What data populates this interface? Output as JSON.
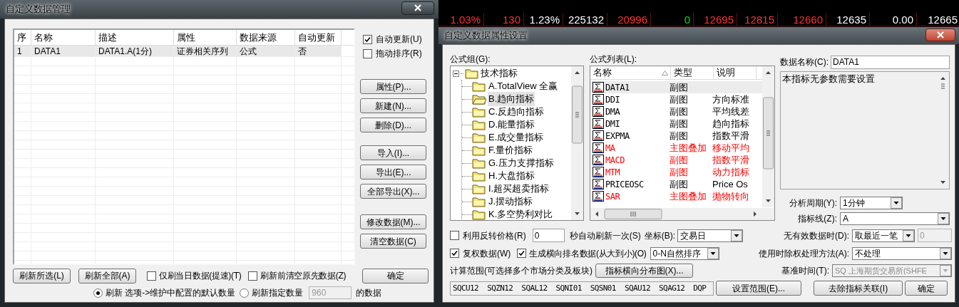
{
  "ticker": {
    "rows": [
      {
        "cells": [
          {
            "text": "1.03%",
            "color": "#ff3232"
          },
          {
            "text": "130",
            "color": "#ff3232"
          },
          {
            "text": "1.23%",
            "color": "#ffffff"
          },
          {
            "text": "225132",
            "color": "#ffffff"
          },
          {
            "text": "20996",
            "color": "#ff3232"
          },
          {
            "text": "0",
            "color": "#00e600"
          },
          {
            "text": "12695",
            "color": "#ff3232"
          },
          {
            "text": "12815",
            "color": "#ff3232"
          },
          {
            "text": "12660",
            "color": "#ff3232"
          },
          {
            "text": "12635",
            "color": "#ffffff"
          },
          {
            "text": "0.00",
            "color": "#ffffff"
          },
          {
            "text": "12665",
            "color": "#ffffff"
          }
        ]
      }
    ]
  },
  "manager": {
    "title": "自定义数据管理",
    "columns": [
      "序",
      "名称",
      "描述",
      "属性",
      "数据来源",
      "自动更新"
    ],
    "rows": [
      {
        "cells": [
          "1",
          "DATA1",
          "DATA1.A(1分)",
          "证券相关序列",
          "公式",
          "否"
        ],
        "selected": true
      }
    ],
    "options": [
      {
        "label": "自动更新(U)",
        "checked": true
      },
      {
        "label": "拖动排序(R)",
        "checked": false
      }
    ],
    "button_groups": [
      [
        "属性(P)...",
        "新建(N)...",
        "删除(D)..."
      ],
      [
        "导入(I)...",
        "导出(E)...",
        "全部导出(X)..."
      ],
      [
        "修改数据(M)...",
        "清空数据(C)"
      ]
    ],
    "refresh_buttons": [
      "刷新所选(L)",
      "刷新全部(A)"
    ],
    "refresh_options": [
      {
        "label": "仅刷当日数据(提速)(T)",
        "checked": false
      },
      {
        "label": "刷新前清空原先数据(Z)",
        "checked": false
      }
    ],
    "confirm": "确定",
    "modes": [
      {
        "label": "刷新 选项->维护中配置的默认数量",
        "selected": true
      },
      {
        "label": "刷新指定数量",
        "selected": false
      }
    ],
    "count": {
      "value": "960",
      "disabled": true
    },
    "count_suffix": "的数据"
  },
  "properties": {
    "title": "自定义数据属性设置",
    "group_label": "公式组(G):",
    "tree": {
      "label": "技术指标",
      "expanded": true,
      "children": [
        {
          "label": "A.TotalView 全赢",
          "selected": false
        },
        {
          "label": "B.趋向指标",
          "selected": true
        },
        {
          "label": "C.反趋向指标",
          "selected": false
        },
        {
          "label": "D.能量指标",
          "selected": false
        },
        {
          "label": "E.成交量指标",
          "selected": false
        },
        {
          "label": "F.量价指标",
          "selected": false
        },
        {
          "label": "G.压力支撑指标",
          "selected": false
        },
        {
          "label": "H.大盘指标",
          "selected": false
        },
        {
          "label": "I.超买超卖指标",
          "selected": false
        },
        {
          "label": "J.摆动指标",
          "selected": false
        },
        {
          "label": "K.多空势利对比",
          "selected": false
        }
      ]
    },
    "list_label": "公式列表(L):",
    "list_columns": [
      {
        "label": "名称",
        "sorted": true
      },
      {
        "label": "类型",
        "sorted": false
      },
      {
        "label": "说明",
        "sorted": false
      }
    ],
    "list_rows": [
      {
        "name": "DATA1",
        "type": "副图",
        "desc": "",
        "color": "#000000",
        "selected": true
      },
      {
        "name": "DDI",
        "type": "副图",
        "desc": "方向标准",
        "color": "#000000",
        "selected": false
      },
      {
        "name": "DMA",
        "type": "副图",
        "desc": "平均线差",
        "color": "#000000",
        "selected": false
      },
      {
        "name": "DMI",
        "type": "副图",
        "desc": "趋向指标",
        "color": "#000000",
        "selected": false
      },
      {
        "name": "EXPMA",
        "type": "副图",
        "desc": "指数平滑",
        "color": "#000000",
        "selected": false
      },
      {
        "name": "MA",
        "type": "主图叠加",
        "desc": "移动平均",
        "color": "#ff0000",
        "selected": false
      },
      {
        "name": "MACD",
        "type": "副图",
        "desc": "指数平滑",
        "color": "#ff0000",
        "selected": false
      },
      {
        "name": "MTM",
        "type": "副图",
        "desc": "动力指标",
        "color": "#ff0000",
        "selected": false
      },
      {
        "name": "PRICEOSC",
        "type": "副图",
        "desc": "Price Os",
        "color": "#000000",
        "selected": false
      },
      {
        "name": "SAR",
        "type": "主图叠加",
        "desc": "抛物转向",
        "color": "#ff0000",
        "selected": false
      }
    ],
    "name_label": "数据名称(C):",
    "name_value": "DATA1",
    "param_text": "本指标无参数需要设置",
    "period": {
      "label": "分析周期(Y):",
      "value": "1分钟"
    },
    "line": {
      "label": "指标线(Z):",
      "value": "A"
    },
    "reverse": {
      "label": "利用反转价格(R)",
      "checked": false
    },
    "refresh_seconds": "0",
    "refresh_suffix": "秒自动刷新一次(S)",
    "axis": {
      "label": "坐标(B):",
      "value": "交易日"
    },
    "no_data": {
      "label": "无有效数据时(D):",
      "value": "取最近一笔",
      "extra": "0",
      "extra_disabled": true
    },
    "adjust": {
      "label": "复权数据(W)",
      "checked": true
    },
    "rank": {
      "label": "生成横向排名数据(从大到小)(O)",
      "checked": true
    },
    "rank_order": "0-N自然排序",
    "exright": {
      "label": "使用时除权处理方法(A):",
      "value": "不处理"
    },
    "range_label": "计算范围(可选择多个市场分类及板块)",
    "distribution_button": "指标横向分布图(X)...",
    "base_time": {
      "label": "基准时间(T):",
      "value": "SQ 上海期货交易所(SHFE",
      "disabled": true
    },
    "range_value": "SQCU12  SQZN12  SQAL12  SQNI01  SQSN01  SQAU12  SQAG12  DQP",
    "buttons": [
      "设置范围(E)...",
      "去除指标关联(I)",
      "确定"
    ]
  }
}
